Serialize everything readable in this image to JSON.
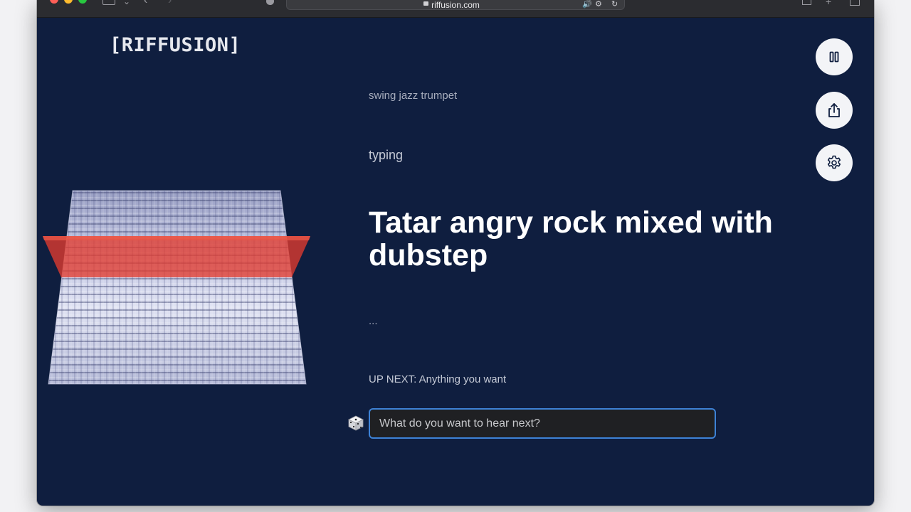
{
  "browser": {
    "url": "riffusion.com"
  },
  "app": {
    "logo": "[RIFFUSION]"
  },
  "player": {
    "previous_prompt": "swing jazz trumpet",
    "status": "typing",
    "current_prompt": "Tatar angry rock mixed with dubstep",
    "ellipsis": "...",
    "up_next": "UP NEXT: Anything you want"
  },
  "prompt_input": {
    "placeholder": "What do you want to hear next?",
    "value": ""
  },
  "side_controls": [
    {
      "icon": "pause-icon"
    },
    {
      "icon": "share-icon"
    },
    {
      "icon": "gear-icon"
    }
  ],
  "colors": {
    "background": "#0f1e3f",
    "highlight": "#e23b2e",
    "input_focus": "#3d82d6"
  }
}
